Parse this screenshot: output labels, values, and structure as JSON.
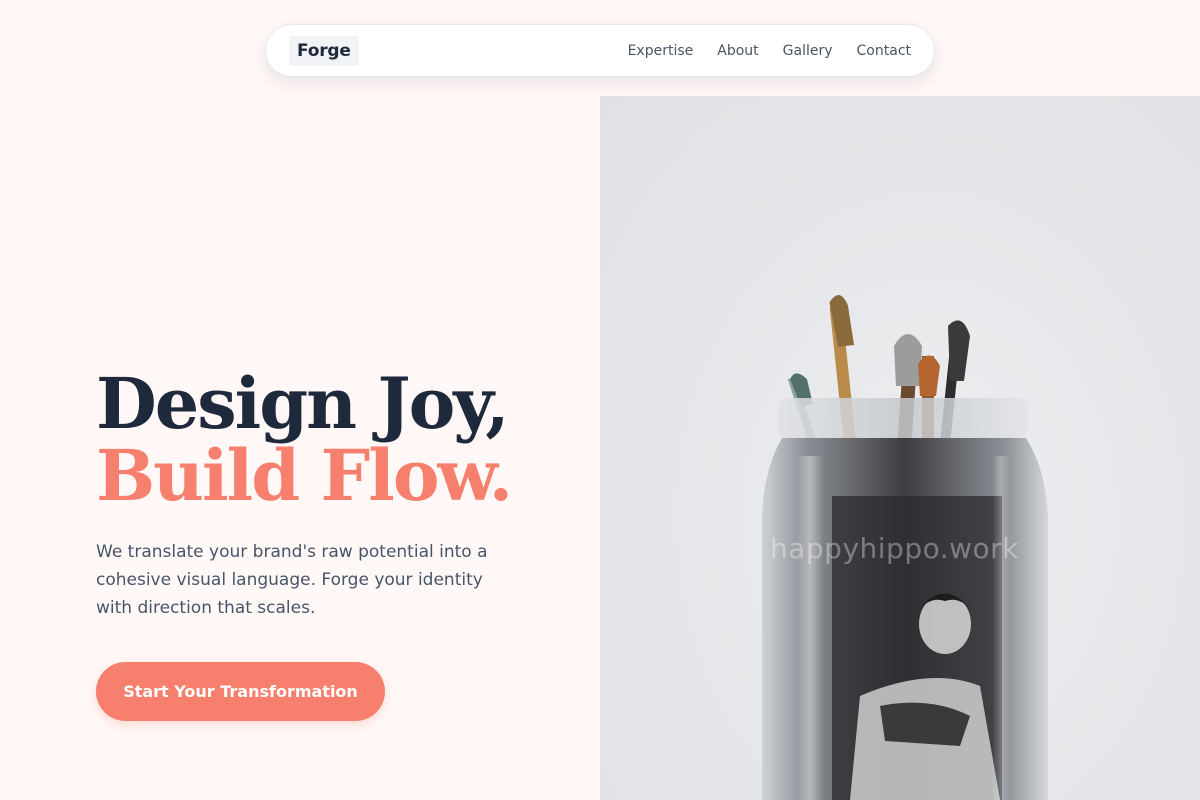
{
  "nav": {
    "logo": "Forge",
    "links": [
      {
        "label": "Expertise"
      },
      {
        "label": "About"
      },
      {
        "label": "Gallery"
      },
      {
        "label": "Contact"
      }
    ]
  },
  "hero": {
    "headline_line1": "Design Joy,",
    "headline_line2": "Build Flow.",
    "subtext": "We translate your brand's raw potential into a cohesive visual language. Forge your identity with direction that scales.",
    "cta_label": "Start Your Transformation",
    "image_watermark": "happyhippo.work"
  },
  "colors": {
    "page_background": "#fff8f7",
    "accent": "#f67f6d",
    "heading_dark": "#1e293b",
    "body_text": "#475569",
    "nav_text": "#4b5563"
  },
  "icons": {
    "hero_image": "paintbrush-jar-photo"
  }
}
